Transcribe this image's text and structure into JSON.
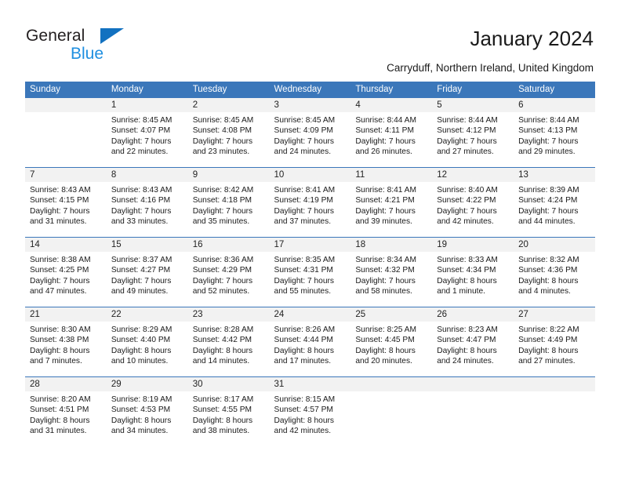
{
  "brand": {
    "name_top": "General",
    "name_bottom": "Blue",
    "accent_color": "#1271c0",
    "blue_text_color": "#1f8fe0"
  },
  "header": {
    "title": "January 2024",
    "subtitle": "Carryduff, Northern Ireland, United Kingdom",
    "header_bg_color": "#3b77ba",
    "daynum_bg_color": "#f2f2f2"
  },
  "weekday_headers": [
    "Sunday",
    "Monday",
    "Tuesday",
    "Wednesday",
    "Thursday",
    "Friday",
    "Saturday"
  ],
  "labels": {
    "sunrise": "Sunrise:",
    "sunset": "Sunset:",
    "daylight": "Daylight:"
  },
  "weeks": [
    [
      {
        "day": "",
        "empty": true
      },
      {
        "day": "1",
        "sunrise": "Sunrise: 8:45 AM",
        "sunset": "Sunset: 4:07 PM",
        "daylight1": "Daylight: 7 hours",
        "daylight2": "and 22 minutes."
      },
      {
        "day": "2",
        "sunrise": "Sunrise: 8:45 AM",
        "sunset": "Sunset: 4:08 PM",
        "daylight1": "Daylight: 7 hours",
        "daylight2": "and 23 minutes."
      },
      {
        "day": "3",
        "sunrise": "Sunrise: 8:45 AM",
        "sunset": "Sunset: 4:09 PM",
        "daylight1": "Daylight: 7 hours",
        "daylight2": "and 24 minutes."
      },
      {
        "day": "4",
        "sunrise": "Sunrise: 8:44 AM",
        "sunset": "Sunset: 4:11 PM",
        "daylight1": "Daylight: 7 hours",
        "daylight2": "and 26 minutes."
      },
      {
        "day": "5",
        "sunrise": "Sunrise: 8:44 AM",
        "sunset": "Sunset: 4:12 PM",
        "daylight1": "Daylight: 7 hours",
        "daylight2": "and 27 minutes."
      },
      {
        "day": "6",
        "sunrise": "Sunrise: 8:44 AM",
        "sunset": "Sunset: 4:13 PM",
        "daylight1": "Daylight: 7 hours",
        "daylight2": "and 29 minutes."
      }
    ],
    [
      {
        "day": "7",
        "sunrise": "Sunrise: 8:43 AM",
        "sunset": "Sunset: 4:15 PM",
        "daylight1": "Daylight: 7 hours",
        "daylight2": "and 31 minutes."
      },
      {
        "day": "8",
        "sunrise": "Sunrise: 8:43 AM",
        "sunset": "Sunset: 4:16 PM",
        "daylight1": "Daylight: 7 hours",
        "daylight2": "and 33 minutes."
      },
      {
        "day": "9",
        "sunrise": "Sunrise: 8:42 AM",
        "sunset": "Sunset: 4:18 PM",
        "daylight1": "Daylight: 7 hours",
        "daylight2": "and 35 minutes."
      },
      {
        "day": "10",
        "sunrise": "Sunrise: 8:41 AM",
        "sunset": "Sunset: 4:19 PM",
        "daylight1": "Daylight: 7 hours",
        "daylight2": "and 37 minutes."
      },
      {
        "day": "11",
        "sunrise": "Sunrise: 8:41 AM",
        "sunset": "Sunset: 4:21 PM",
        "daylight1": "Daylight: 7 hours",
        "daylight2": "and 39 minutes."
      },
      {
        "day": "12",
        "sunrise": "Sunrise: 8:40 AM",
        "sunset": "Sunset: 4:22 PM",
        "daylight1": "Daylight: 7 hours",
        "daylight2": "and 42 minutes."
      },
      {
        "day": "13",
        "sunrise": "Sunrise: 8:39 AM",
        "sunset": "Sunset: 4:24 PM",
        "daylight1": "Daylight: 7 hours",
        "daylight2": "and 44 minutes."
      }
    ],
    [
      {
        "day": "14",
        "sunrise": "Sunrise: 8:38 AM",
        "sunset": "Sunset: 4:25 PM",
        "daylight1": "Daylight: 7 hours",
        "daylight2": "and 47 minutes."
      },
      {
        "day": "15",
        "sunrise": "Sunrise: 8:37 AM",
        "sunset": "Sunset: 4:27 PM",
        "daylight1": "Daylight: 7 hours",
        "daylight2": "and 49 minutes."
      },
      {
        "day": "16",
        "sunrise": "Sunrise: 8:36 AM",
        "sunset": "Sunset: 4:29 PM",
        "daylight1": "Daylight: 7 hours",
        "daylight2": "and 52 minutes."
      },
      {
        "day": "17",
        "sunrise": "Sunrise: 8:35 AM",
        "sunset": "Sunset: 4:31 PM",
        "daylight1": "Daylight: 7 hours",
        "daylight2": "and 55 minutes."
      },
      {
        "day": "18",
        "sunrise": "Sunrise: 8:34 AM",
        "sunset": "Sunset: 4:32 PM",
        "daylight1": "Daylight: 7 hours",
        "daylight2": "and 58 minutes."
      },
      {
        "day": "19",
        "sunrise": "Sunrise: 8:33 AM",
        "sunset": "Sunset: 4:34 PM",
        "daylight1": "Daylight: 8 hours",
        "daylight2": "and 1 minute."
      },
      {
        "day": "20",
        "sunrise": "Sunrise: 8:32 AM",
        "sunset": "Sunset: 4:36 PM",
        "daylight1": "Daylight: 8 hours",
        "daylight2": "and 4 minutes."
      }
    ],
    [
      {
        "day": "21",
        "sunrise": "Sunrise: 8:30 AM",
        "sunset": "Sunset: 4:38 PM",
        "daylight1": "Daylight: 8 hours",
        "daylight2": "and 7 minutes."
      },
      {
        "day": "22",
        "sunrise": "Sunrise: 8:29 AM",
        "sunset": "Sunset: 4:40 PM",
        "daylight1": "Daylight: 8 hours",
        "daylight2": "and 10 minutes."
      },
      {
        "day": "23",
        "sunrise": "Sunrise: 8:28 AM",
        "sunset": "Sunset: 4:42 PM",
        "daylight1": "Daylight: 8 hours",
        "daylight2": "and 14 minutes."
      },
      {
        "day": "24",
        "sunrise": "Sunrise: 8:26 AM",
        "sunset": "Sunset: 4:44 PM",
        "daylight1": "Daylight: 8 hours",
        "daylight2": "and 17 minutes."
      },
      {
        "day": "25",
        "sunrise": "Sunrise: 8:25 AM",
        "sunset": "Sunset: 4:45 PM",
        "daylight1": "Daylight: 8 hours",
        "daylight2": "and 20 minutes."
      },
      {
        "day": "26",
        "sunrise": "Sunrise: 8:23 AM",
        "sunset": "Sunset: 4:47 PM",
        "daylight1": "Daylight: 8 hours",
        "daylight2": "and 24 minutes."
      },
      {
        "day": "27",
        "sunrise": "Sunrise: 8:22 AM",
        "sunset": "Sunset: 4:49 PM",
        "daylight1": "Daylight: 8 hours",
        "daylight2": "and 27 minutes."
      }
    ],
    [
      {
        "day": "28",
        "sunrise": "Sunrise: 8:20 AM",
        "sunset": "Sunset: 4:51 PM",
        "daylight1": "Daylight: 8 hours",
        "daylight2": "and 31 minutes."
      },
      {
        "day": "29",
        "sunrise": "Sunrise: 8:19 AM",
        "sunset": "Sunset: 4:53 PM",
        "daylight1": "Daylight: 8 hours",
        "daylight2": "and 34 minutes."
      },
      {
        "day": "30",
        "sunrise": "Sunrise: 8:17 AM",
        "sunset": "Sunset: 4:55 PM",
        "daylight1": "Daylight: 8 hours",
        "daylight2": "and 38 minutes."
      },
      {
        "day": "31",
        "sunrise": "Sunrise: 8:15 AM",
        "sunset": "Sunset: 4:57 PM",
        "daylight1": "Daylight: 8 hours",
        "daylight2": "and 42 minutes."
      },
      {
        "day": "",
        "empty": true
      },
      {
        "day": "",
        "empty": true
      },
      {
        "day": "",
        "empty": true
      }
    ]
  ]
}
